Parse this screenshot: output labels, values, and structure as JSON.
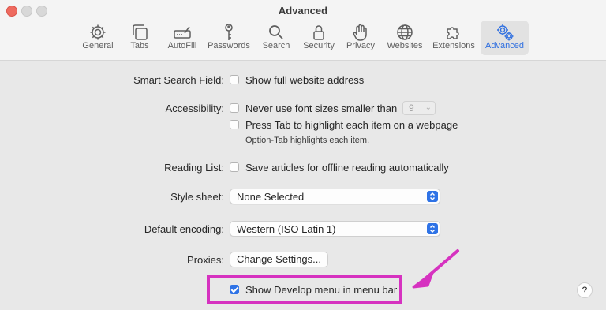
{
  "window": {
    "title": "Advanced"
  },
  "toolbar": {
    "items": [
      {
        "label": "General",
        "icon": "gear-icon"
      },
      {
        "label": "Tabs",
        "icon": "tabs-icon"
      },
      {
        "label": "AutoFill",
        "icon": "autofill-icon"
      },
      {
        "label": "Passwords",
        "icon": "key-icon"
      },
      {
        "label": "Search",
        "icon": "search-icon"
      },
      {
        "label": "Security",
        "icon": "lock-icon"
      },
      {
        "label": "Privacy",
        "icon": "hand-icon"
      },
      {
        "label": "Websites",
        "icon": "globe-icon"
      },
      {
        "label": "Extensions",
        "icon": "puzzle-icon"
      },
      {
        "label": "Advanced",
        "icon": "gears-icon",
        "active": true
      }
    ]
  },
  "settings": {
    "smart_search": {
      "label": "Smart Search Field:",
      "option": "Show full website address",
      "checked": false
    },
    "accessibility": {
      "label": "Accessibility:",
      "min_font_option": "Never use font sizes smaller than",
      "min_font_value": "9",
      "tab_option": "Press Tab to highlight each item on a webpage",
      "tab_hint": "Option-Tab highlights each item."
    },
    "reading_list": {
      "label": "Reading List:",
      "option": "Save articles for offline reading automatically",
      "checked": false
    },
    "style_sheet": {
      "label": "Style sheet:",
      "value": "None Selected"
    },
    "encoding": {
      "label": "Default encoding:",
      "value": "Western (ISO Latin 1)"
    },
    "proxies": {
      "label": "Proxies:",
      "button": "Change Settings..."
    },
    "develop_menu": {
      "option": "Show Develop menu in menu bar",
      "checked": true
    }
  },
  "help": {
    "label": "?"
  },
  "colors": {
    "accent": "#2f73e6",
    "annotation": "#d632c0"
  }
}
